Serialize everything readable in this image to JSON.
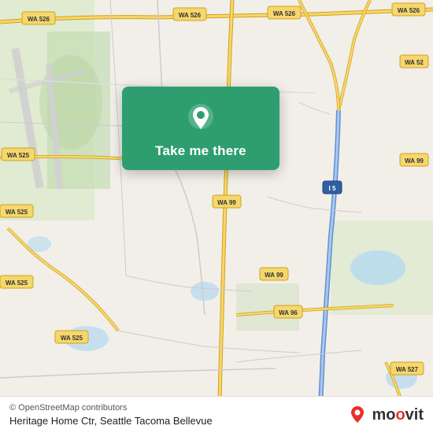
{
  "map": {
    "attribution": "© OpenStreetMap contributors",
    "location": "Heritage Home Ctr, Seattle Tacoma Bellevue",
    "cta_label": "Take me there",
    "moovit_brand": "moovit",
    "bg_color": "#f2efe9"
  },
  "roads": {
    "highway_color": "#f5d76e",
    "highway_stroke": "#d4a017",
    "road_color": "#ffffff",
    "road_stroke": "#bbbbbb",
    "green_area": "#c8e6c0",
    "water_color": "#b3d9f0",
    "route_labels": [
      "WA 526",
      "WA 525",
      "WA 99",
      "WA 96",
      "WA 527",
      "I 5"
    ]
  },
  "pin": {
    "bg": "#2e9e6e",
    "icon_color": "#ffffff"
  },
  "moovit": {
    "text": "moovit",
    "accent_color": "#e8302a"
  }
}
